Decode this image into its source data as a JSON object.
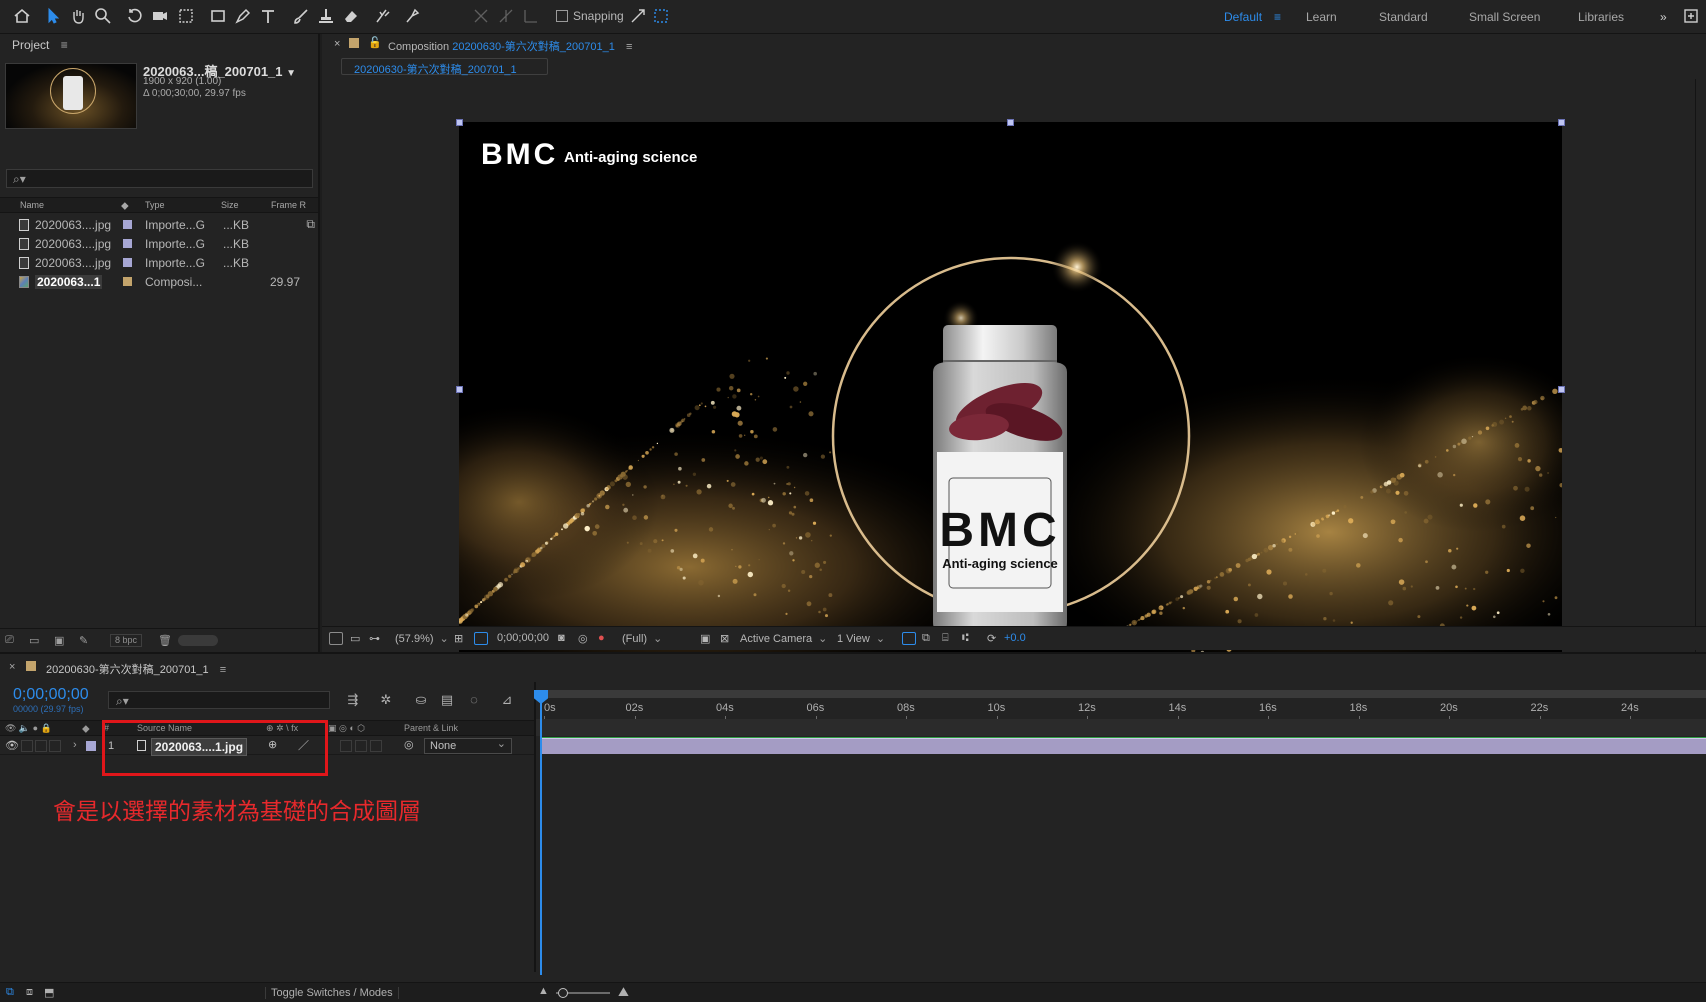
{
  "workspaces": {
    "default": "Default",
    "learn": "Learn",
    "standard": "Standard",
    "small_screen": "Small Screen",
    "libraries": "Libraries",
    "more": "»"
  },
  "toolbar": {
    "snapping_label": "Snapping",
    "tools": [
      "home-icon",
      "selection-tool",
      "hand-tool",
      "zoom-tool",
      "rotation-tool",
      "camera-tool",
      "pan-behind-tool",
      "rectangle-tool",
      "pen-tool",
      "type-tool",
      "brush-tool",
      "clone-stamp-tool",
      "eraser-tool",
      "roto-brush-tool",
      "puppet-tool"
    ]
  },
  "project": {
    "panel_title": "Project",
    "item_name": "2020063...稿_200701_1",
    "dimensions": "1900 x 920 (1.00)",
    "duration": "Δ 0;00;30;00, 29.97 fps",
    "columns": {
      "name": "Name",
      "type": "Type",
      "size": "Size",
      "frame": "Frame R"
    },
    "items": [
      {
        "name": "2020063....jpg",
        "type": "Importe...G",
        "size": "...KB",
        "frame": "",
        "label_color": "#a7a7d4"
      },
      {
        "name": "2020063....jpg",
        "type": "Importe...G",
        "size": "...KB",
        "frame": "",
        "label_color": "#a7a7d4"
      },
      {
        "name": "2020063....jpg",
        "type": "Importe...G",
        "size": "...KB",
        "frame": "",
        "label_color": "#a7a7d4"
      },
      {
        "name": "2020063...1",
        "type": "Composi...",
        "size": "",
        "frame": "29.97",
        "label_color": "#c3a46c"
      }
    ],
    "bpc": "8 bpc"
  },
  "composition": {
    "tab_prefix": "Composition",
    "tab_name": "20200630-第六次對稿_200701_1",
    "subtab": "20200630-第六次對稿_200701_1",
    "canvas": {
      "brand": "BMC",
      "tagline": "Anti-aging science",
      "bottle_brand": "BMC",
      "bottle_tagline": "Anti-aging science"
    }
  },
  "viewer_controls": {
    "zoom": "(57.9%)",
    "timecode": "0;00;00;00",
    "resolution": "(Full)",
    "camera": "Active Camera",
    "views": "1 View",
    "exposure": "+0.0"
  },
  "timeline": {
    "tab_name": "20200630-第六次對稿_200701_1",
    "timecode": "0;00;00;00",
    "fps_info": "00000 (29.97 fps)",
    "columns": {
      "num": "#",
      "source": "Source Name",
      "parent": "Parent & Link"
    },
    "layer": {
      "index": "1",
      "name": "2020063....1.jpg",
      "parent": "None"
    },
    "ruler_ticks": [
      "0s",
      "02s",
      "04s",
      "06s",
      "08s",
      "10s",
      "12s",
      "14s",
      "16s",
      "18s",
      "20s",
      "22s",
      "24s",
      "2"
    ],
    "toggle_label": "Toggle Switches / Modes"
  },
  "annotation": {
    "text": "會是以選擇的素材為基礎的合成圖層",
    "color": "#e7292c"
  }
}
